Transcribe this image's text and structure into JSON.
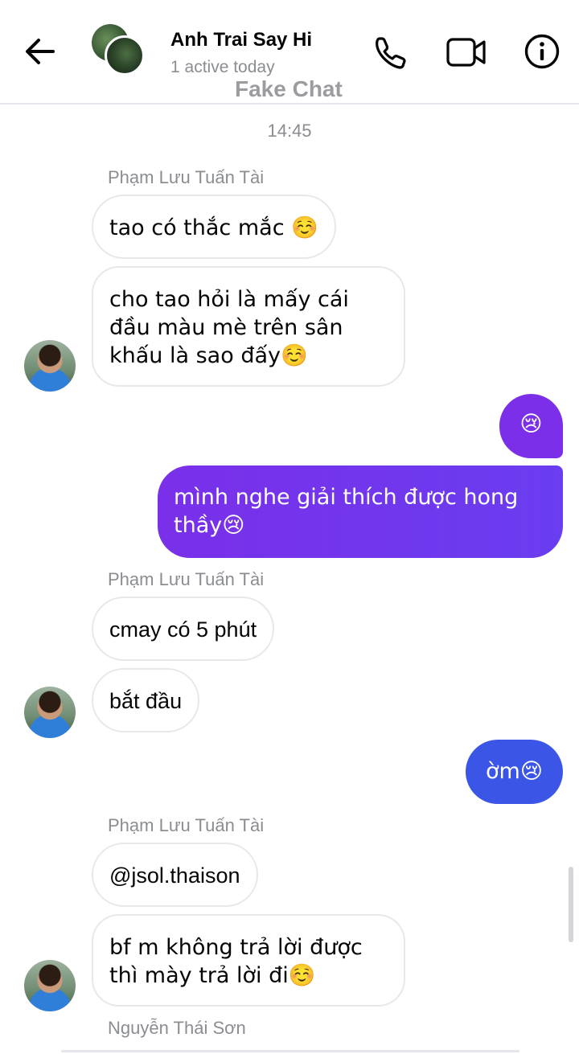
{
  "header": {
    "title": "Anh Trai Say Hi",
    "status": "1 active today",
    "watermark": "Fake Chat"
  },
  "chat": {
    "timestamp": "14:45",
    "groups": [
      {
        "sender": "Phạm Lưu Tuấn Tài",
        "messages": [
          "tao có thắc mắc ☺️",
          "cho tao hỏi là mấy cái đầu màu mè trên sân khấu là sao đấy☺️"
        ]
      },
      {
        "outgoing": [
          "😢",
          "mình nghe giải thích được hong thầy😢"
        ]
      },
      {
        "sender": "Phạm Lưu Tuấn Tài",
        "messages": [
          "cmay có 5 phút",
          "bắt đầu"
        ]
      },
      {
        "outgoing": [
          "ờm😢"
        ]
      },
      {
        "sender": "Phạm Lưu Tuấn Tài",
        "messages": [
          "@jsol.thaison",
          "bf m không trả lời được thì mày trả lời đi☺️"
        ]
      },
      {
        "sender": "Nguyễn Thái Sơn"
      }
    ]
  },
  "colors": {
    "outgoing_purple": "#7b2fe8",
    "outgoing_gradient_end": "#6a3df0",
    "outgoing_blue": "#3b55e6",
    "incoming_bg": "#ffffff",
    "meta_text": "#8a8d91"
  },
  "icons": [
    "back-arrow-icon",
    "phone-icon",
    "video-camera-icon",
    "info-icon"
  ]
}
